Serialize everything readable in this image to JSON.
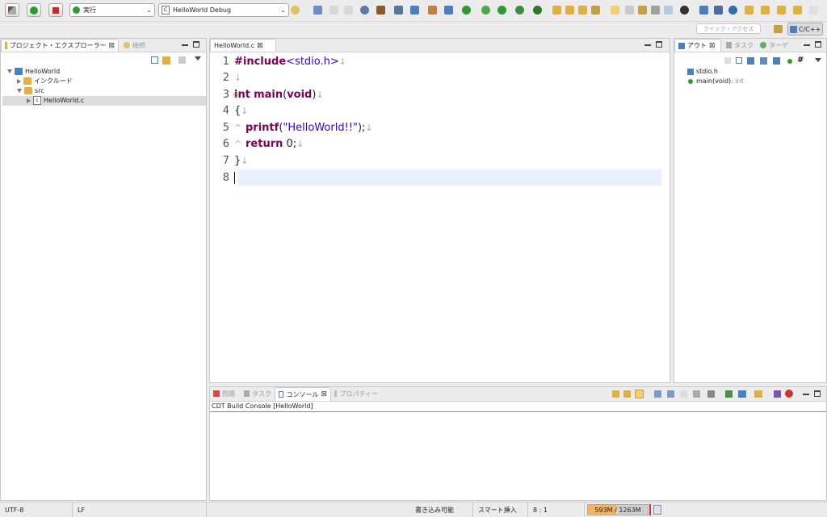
{
  "toolbar": {
    "run_mode": "実行",
    "launch_config": "HelloWorld Debug"
  },
  "quick_access": {
    "placeholder": "クイック・アクセス"
  },
  "perspective": {
    "label": "C/C++"
  },
  "project_explorer": {
    "tabs": [
      {
        "label": "プロジェクト・エクスプローラー"
      },
      {
        "label": "接続"
      }
    ],
    "tree": {
      "project": "HelloWorld",
      "includes": "インクルード",
      "src": "src",
      "file": "HelloWorld.c"
    }
  },
  "editor": {
    "tab_label": "HelloWorld.c",
    "lines": [
      {
        "num": "1"
      },
      {
        "num": "2"
      },
      {
        "num": "3"
      },
      {
        "num": "4"
      },
      {
        "num": "5"
      },
      {
        "num": "6"
      },
      {
        "num": "7"
      },
      {
        "num": "8"
      }
    ],
    "code": {
      "include_kw": "#include",
      "include_hdr": "<stdio.h>",
      "int_kw": "int",
      "main_fn": "main",
      "paren_open": "(",
      "void_kw": "void",
      "paren_close": ")",
      "brace_open": "{",
      "printf_fn": "printf",
      "printf_open": "(",
      "printf_str": "\"HelloWorld!!\"",
      "printf_close": ");",
      "return_kw": "return",
      "return_val": "0;",
      "brace_close": "}",
      "newline_mark": "↓",
      "tab_mark": "^"
    }
  },
  "outline": {
    "tabs": [
      {
        "label": "アウト"
      },
      {
        "label": "タスク"
      },
      {
        "label": "ターゲ"
      }
    ],
    "items": [
      {
        "label": "stdio.h",
        "detail": ""
      },
      {
        "label": "main(void)",
        "detail": " : int"
      }
    ]
  },
  "bottom": {
    "tabs": [
      {
        "label": "問題"
      },
      {
        "label": "タスク"
      },
      {
        "label": "コンソール"
      },
      {
        "label": "プロパティー"
      }
    ],
    "console_title": "CDT Build Console [HelloWorld]"
  },
  "status": {
    "encoding": "UTF-8",
    "line_ending": "LF",
    "writable": "書き込み可能",
    "insert_mode": "スマート挿入",
    "position": "8 : 1",
    "heap": "593M / 1263M",
    "heap_used_fraction": 0.47
  },
  "colors": {
    "accent_run": "#2a9d2a",
    "accent_stop": "#d22",
    "keyword": "#7f0055",
    "string": "#2a00ff",
    "current_line": "#e8f2fe",
    "heap_fill": "#f5b35c"
  }
}
